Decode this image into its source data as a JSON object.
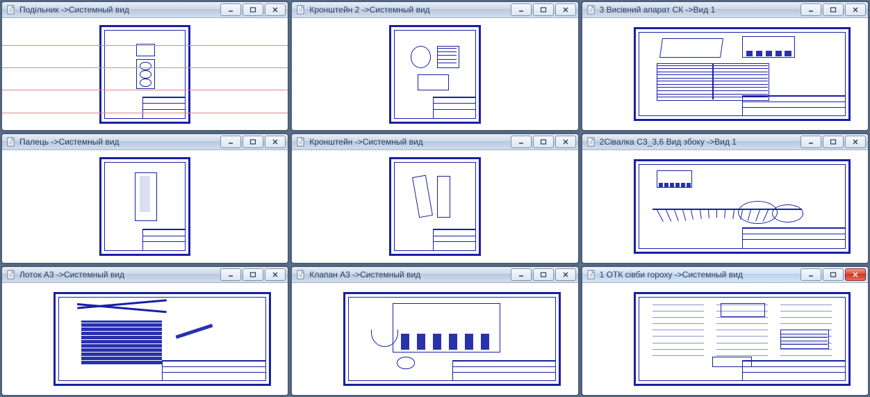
{
  "windows": [
    {
      "title": "Подільник ->Системный вид",
      "orient": "pt",
      "active": false,
      "kind": "divider"
    },
    {
      "title": "Кронштейн 2 ->Системный вид",
      "orient": "pt",
      "active": false,
      "kind": "bracket2"
    },
    {
      "title": "3 Висівний апарат СК ->Вид 1",
      "orient": "ls",
      "active": false,
      "kind": "sower"
    },
    {
      "title": "Палець ->Системный вид",
      "orient": "pt",
      "active": false,
      "kind": "finger"
    },
    {
      "title": "Кронштейн ->Системный вид",
      "orient": "pt",
      "active": false,
      "kind": "bracket"
    },
    {
      "title": "2Сівалка СЗ_3,6 Вид збоку ->Вид 1",
      "orient": "ls",
      "active": false,
      "kind": "seeder"
    },
    {
      "title": "Лоток А3 ->Системный вид",
      "orient": "ls",
      "active": false,
      "kind": "tray"
    },
    {
      "title": "Клапан А3 ->Системный вид",
      "orient": "ls",
      "active": false,
      "kind": "valve"
    },
    {
      "title": "1 ОТК сівби гороху ->Системный вид",
      "orient": "ls",
      "active": true,
      "kind": "otk"
    }
  ],
  "icons": {
    "doc": "document-icon",
    "min": "minimize-icon",
    "max": "maximize-icon",
    "close": "close-icon"
  },
  "btn_tips": {
    "min": "Minimize",
    "max": "Restore",
    "close": "Close"
  }
}
